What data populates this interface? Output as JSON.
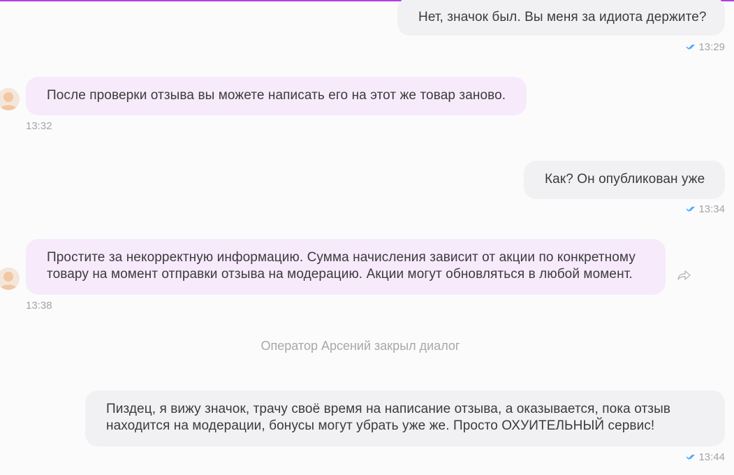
{
  "colors": {
    "accent": "#b23fe0",
    "outgoing_bubble": "#f1f1f3",
    "incoming_bubble": "#f6eafb",
    "read_check": "#3fa4ff",
    "timestamp": "#a4a4a8"
  },
  "messages": [
    {
      "direction": "out",
      "text": "Нет, значок был. Вы меня за идиота держите?",
      "time": "13:29",
      "status_icon": "double-check-icon"
    },
    {
      "direction": "in",
      "text": "После проверки отзыва вы можете написать его на этот же товар заново.",
      "time": "13:32",
      "avatar_icon": "operator-avatar"
    },
    {
      "direction": "out",
      "text": "Как? Он опубликован уже",
      "time": "13:34",
      "status_icon": "double-check-icon"
    },
    {
      "direction": "in",
      "text_lines": [
        "Простите за некорректную информацию. Сумма начисления зависит от акции по конкретному",
        "товару на момент отправки отзыва на модерацию. Акции могут обновляться в любой момент."
      ],
      "time": "13:38",
      "avatar_icon": "operator-avatar",
      "action_icon": "share-arrow-icon"
    },
    {
      "direction": "out",
      "text_lines": [
        "Пиздец, я вижу значок, трачу своё время на написание отзыва, а оказывается, пока отзыв",
        "находится на модерации, бонусы могут убрать уже же. Просто ОХУИТЕЛЬНЫЙ сервис!"
      ],
      "time": "13:44",
      "status_icon": "double-check-icon"
    }
  ],
  "system_message": "Оператор Арсений закрыл диалог"
}
